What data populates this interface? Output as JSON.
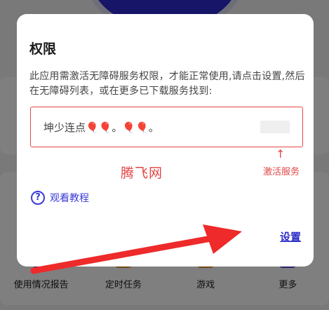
{
  "dialog": {
    "title": "权限",
    "message": "此应用需激活无障碍服务权限，才能正常使用,请点击设置,然后在无障碍列表，或在更多已下载服务找到:",
    "service_name": "坤少连点🎈🎈。🎈🎈。",
    "activate_hint": "激活服务",
    "up_arrow": "↑",
    "watermark": "腾飞网",
    "tutorial_label": "观看教程",
    "help_icon_glyph": "?",
    "settings_label": "设置"
  },
  "bottom_bar": {
    "items": [
      {
        "label": "使用情况报告",
        "icon": "report-icon",
        "color": "#6b3fd6"
      },
      {
        "label": "定时任务",
        "icon": "timer-icon",
        "color": "#e08a2a"
      },
      {
        "label": "游戏",
        "icon": "game-icon",
        "color": "#e08a2a"
      },
      {
        "label": "更多",
        "icon": "more-icon",
        "color": "#4a4ad8"
      }
    ]
  },
  "colors": {
    "accent_red": "#e24646",
    "link_blue": "#2a2ac8",
    "brand_blue": "#2c2bd0",
    "arrow_red": "#ee2a2a"
  }
}
